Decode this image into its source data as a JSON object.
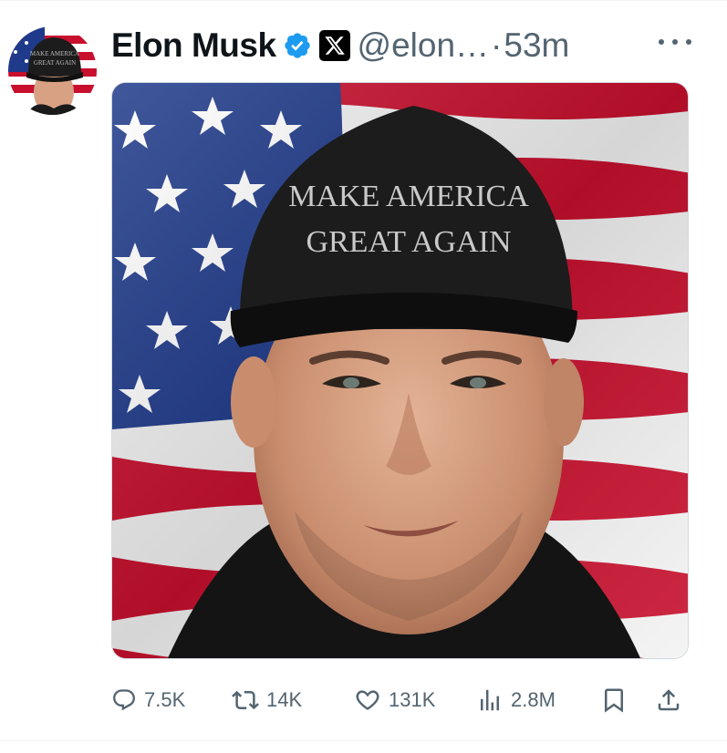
{
  "tweet": {
    "author_name": "Elon Musk",
    "handle": "@elon…",
    "separator": "·",
    "time_ago": "53m",
    "verified": true,
    "image": {
      "hat_line1": "MAKE AMERICA",
      "hat_line2": "GREAT AGAIN"
    },
    "avatar_hat_line1": "MAKE AMERICA",
    "avatar_hat_line2": "GREAT AGAIN"
  },
  "actions": {
    "replies": "7.5K",
    "reposts": "14K",
    "likes": "131K",
    "views": "2.8M"
  },
  "icons": [
    "verified-badge-icon",
    "x-logo-icon",
    "more-icon",
    "reply-icon",
    "repost-icon",
    "like-icon",
    "views-icon",
    "bookmark-icon",
    "share-icon"
  ],
  "colors": {
    "verified_blue": "#1d9bf0",
    "text_primary": "#0f1419",
    "text_secondary": "#536471",
    "flag_red": "#c8102e",
    "flag_blue": "#1f3a8a"
  }
}
